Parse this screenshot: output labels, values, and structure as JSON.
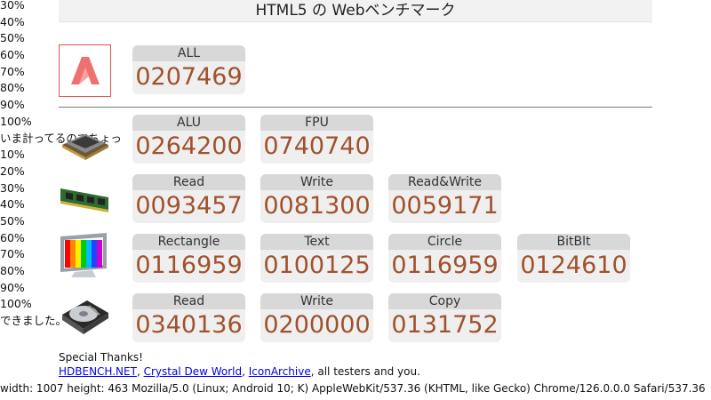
{
  "header": {
    "title": "HTML5 の Webベンチマーク"
  },
  "log": [
    "30%",
    "40%",
    "50%",
    "60%",
    "70%",
    "80%",
    "90%",
    "100%",
    "いま計ってるのでちょっ",
    "10%",
    "20%",
    "30%",
    "40%",
    "50%",
    "60%",
    "70%",
    "80%",
    "90%",
    "100%",
    "できました。"
  ],
  "overall": {
    "label": "ALL",
    "value": "0207469"
  },
  "cpu": [
    {
      "label": "ALU",
      "value": "0264200"
    },
    {
      "label": "FPU",
      "value": "0740740"
    }
  ],
  "memory": [
    {
      "label": "Read",
      "value": "0093457"
    },
    {
      "label": "Write",
      "value": "0081300"
    },
    {
      "label": "Read&Write",
      "value": "0059171"
    }
  ],
  "graphics": [
    {
      "label": "Rectangle",
      "value": "0116959"
    },
    {
      "label": "Text",
      "value": "0100125"
    },
    {
      "label": "Circle",
      "value": "0116959"
    },
    {
      "label": "BitBlt",
      "value": "0124610"
    }
  ],
  "storage": [
    {
      "label": "Read",
      "value": "0340136"
    },
    {
      "label": "Write",
      "value": "0200000"
    },
    {
      "label": "Copy",
      "value": "0131752"
    }
  ],
  "credits": {
    "heading": "Special Thanks!",
    "link1": "HDBENCH.NET",
    "link2": "Crystal Dew World",
    "link3": "IconArchive",
    "suffix": ", all testers and you.",
    "sep": ", "
  },
  "user_agent": "width: 1007 height: 463 Mozilla/5.0 (Linux; Android 10; K) AppleWebKit/537.36 (KHTML, like Gecko) Chrome/126.0.0.0 Safari/537.36",
  "colors": {
    "score_value": "#a0522d",
    "logo_red": "#f07070",
    "logo_border": "#d9534f",
    "link": "#0000ee"
  },
  "icons": [
    "app-logo-icon",
    "cpu-chip-icon",
    "ram-module-icon",
    "monitor-color-bars-icon",
    "hard-disk-icon"
  ]
}
